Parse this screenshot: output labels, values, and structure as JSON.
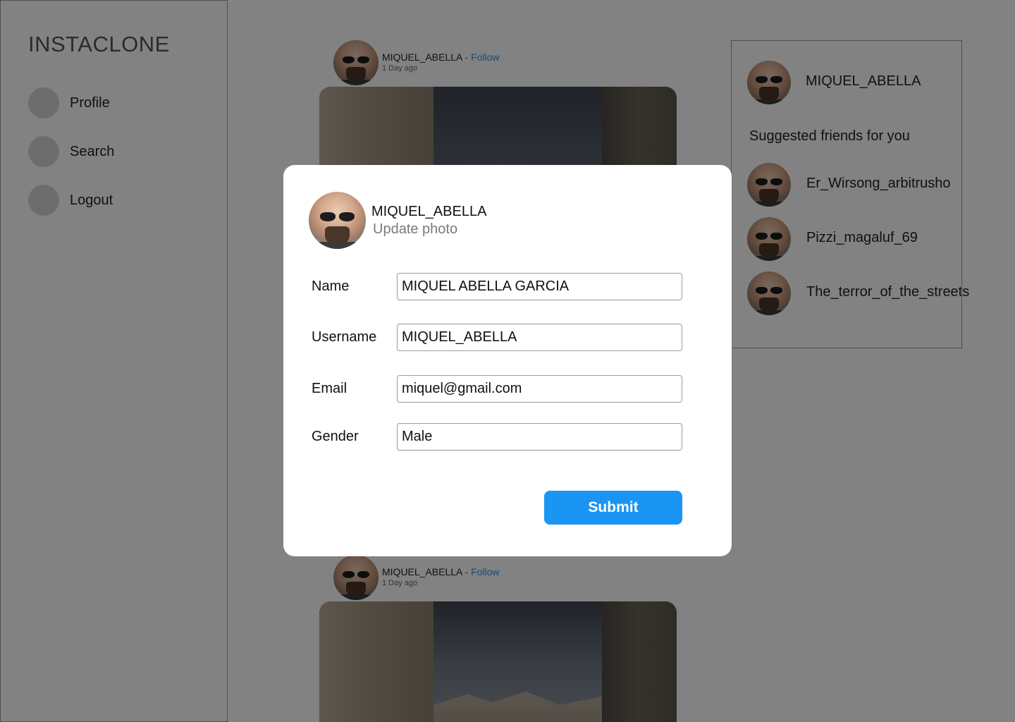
{
  "sidebar": {
    "brand": "INSTACLONE",
    "items": [
      {
        "label": "Profile"
      },
      {
        "label": "Search"
      },
      {
        "label": "Logout"
      }
    ]
  },
  "feed": {
    "posts": [
      {
        "username": "MIQUEL_ABELLA",
        "separator": " - ",
        "follow_label": "Follow",
        "time": "1 Day ago"
      },
      {
        "username": "MIQUEL_ABELLA",
        "separator": " - ",
        "follow_label": "Follow",
        "time": "1 Day ago"
      }
    ]
  },
  "right_panel": {
    "current_user": "MIQUEL_ABELLA",
    "suggested_heading": "Suggested friends for you",
    "suggestions": [
      {
        "username": "Er_Wirsong_arbitrusho"
      },
      {
        "username": "Pizzi_magaluf_69"
      },
      {
        "username": "The_terror_of_the_streets"
      }
    ]
  },
  "modal": {
    "username": "MIQUEL_ABELLA",
    "update_photo_label": "Update photo",
    "fields": {
      "name": {
        "label": "Name",
        "value": "MIQUEL ABELLA GARCIA"
      },
      "username": {
        "label": "Username",
        "value": "MIQUEL_ABELLA"
      },
      "email": {
        "label": "Email",
        "value": "miquel@gmail.com"
      },
      "gender": {
        "label": "Gender",
        "value": "Male"
      }
    },
    "submit_label": "Submit"
  },
  "colors": {
    "accent": "#1b95f3",
    "link": "#2f8ee0",
    "overlay": "rgba(0,0,0,0.49)"
  }
}
